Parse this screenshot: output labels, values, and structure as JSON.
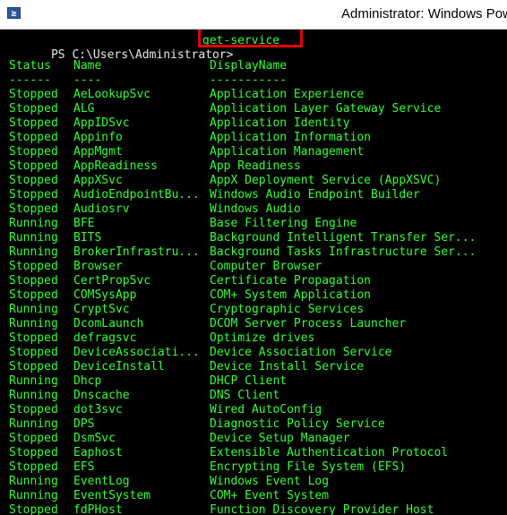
{
  "window": {
    "title": "Administrator: Windows Pow",
    "icon": "powershell-icon",
    "icon_glyph": "≥"
  },
  "console": {
    "prompt": "PS C:\\Users\\Administrator>",
    "command": "get-service",
    "headers": {
      "status": "Status",
      "name": "Name",
      "display": "DisplayName"
    },
    "underlines": {
      "status": "------",
      "name": "----",
      "display": "-----------"
    },
    "rows": [
      {
        "status": "Stopped",
        "name": "AeLookupSvc",
        "display": "Application Experience"
      },
      {
        "status": "Stopped",
        "name": "ALG",
        "display": "Application Layer Gateway Service"
      },
      {
        "status": "Stopped",
        "name": "AppIDSvc",
        "display": "Application Identity"
      },
      {
        "status": "Stopped",
        "name": "Appinfo",
        "display": "Application Information"
      },
      {
        "status": "Stopped",
        "name": "AppMgmt",
        "display": "Application Management"
      },
      {
        "status": "Stopped",
        "name": "AppReadiness",
        "display": "App Readiness"
      },
      {
        "status": "Stopped",
        "name": "AppXSvc",
        "display": "AppX Deployment Service (AppXSVC)"
      },
      {
        "status": "Stopped",
        "name": "AudioEndpointBu...",
        "display": "Windows Audio Endpoint Builder"
      },
      {
        "status": "Stopped",
        "name": "Audiosrv",
        "display": "Windows Audio"
      },
      {
        "status": "Running",
        "name": "BFE",
        "display": "Base Filtering Engine"
      },
      {
        "status": "Running",
        "name": "BITS",
        "display": "Background Intelligent Transfer Ser..."
      },
      {
        "status": "Running",
        "name": "BrokerInfrastru...",
        "display": "Background Tasks Infrastructure Ser..."
      },
      {
        "status": "Stopped",
        "name": "Browser",
        "display": "Computer Browser"
      },
      {
        "status": "Stopped",
        "name": "CertPropSvc",
        "display": "Certificate Propagation"
      },
      {
        "status": "Stopped",
        "name": "COMSysApp",
        "display": "COM+ System Application"
      },
      {
        "status": "Running",
        "name": "CryptSvc",
        "display": "Cryptographic Services"
      },
      {
        "status": "Running",
        "name": "DcomLaunch",
        "display": "DCOM Server Process Launcher"
      },
      {
        "status": "Stopped",
        "name": "defragsvc",
        "display": "Optimize drives"
      },
      {
        "status": "Stopped",
        "name": "DeviceAssociati...",
        "display": "Device Association Service"
      },
      {
        "status": "Stopped",
        "name": "DeviceInstall",
        "display": "Device Install Service"
      },
      {
        "status": "Running",
        "name": "Dhcp",
        "display": "DHCP Client"
      },
      {
        "status": "Running",
        "name": "Dnscache",
        "display": "DNS Client"
      },
      {
        "status": "Stopped",
        "name": "dot3svc",
        "display": "Wired AutoConfig"
      },
      {
        "status": "Running",
        "name": "DPS",
        "display": "Diagnostic Policy Service"
      },
      {
        "status": "Stopped",
        "name": "DsmSvc",
        "display": "Device Setup Manager"
      },
      {
        "status": "Stopped",
        "name": "Eaphost",
        "display": "Extensible Authentication Protocol"
      },
      {
        "status": "Stopped",
        "name": "EFS",
        "display": "Encrypting File System (EFS)"
      },
      {
        "status": "Running",
        "name": "EventLog",
        "display": "Windows Event Log"
      },
      {
        "status": "Running",
        "name": "EventSystem",
        "display": "COM+ Event System"
      },
      {
        "status": "Stopped",
        "name": "fdPHost",
        "display": "Function Discovery Provider Host"
      }
    ]
  },
  "colors": {
    "console_bg": "#000000",
    "console_text": "#33ff33",
    "highlight": "#e60000"
  }
}
